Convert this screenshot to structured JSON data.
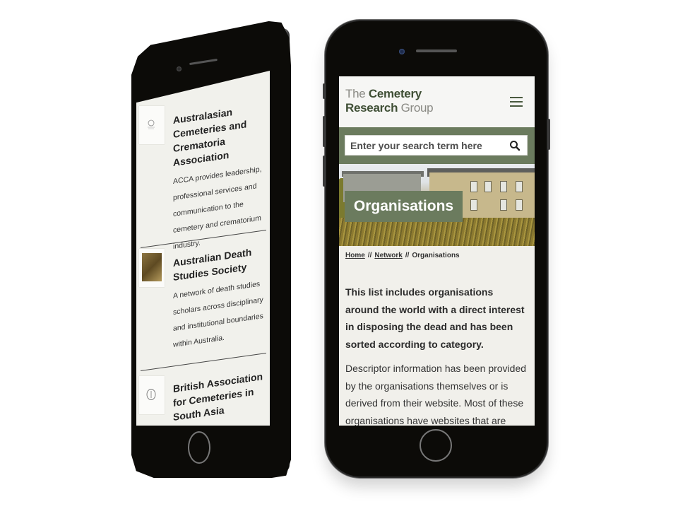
{
  "right_phone": {
    "logo": {
      "line1_light": "The",
      "line1_dark": "Cemetery",
      "line2_dark": "Research",
      "line2_light": "Group"
    },
    "menu_icon": "hamburger-icon",
    "search": {
      "placeholder": "Enter your search term here",
      "value": "",
      "icon": "search-icon"
    },
    "hero": {
      "title": "Organisations"
    },
    "breadcrumb": {
      "items": [
        "Home",
        "Network",
        "Organisations"
      ],
      "separator": "//"
    },
    "content": {
      "lead": "This list includes organisations around the world with a direct interest in disposing the dead and has been sorted according to category.",
      "body": "Descriptor information has been provided by the organisations themselves or is derived from their website. Most of these organisations have websites that are"
    }
  },
  "left_phone": {
    "organisations": [
      {
        "name": "Australasian Cemeteries and Crematoria Association",
        "description": "ACCA provides leadership, professional services and communication to the cemetery and crematorium industry.",
        "thumb": "acca-logo"
      },
      {
        "name": "Australian Death Studies Society",
        "description": "A network of death studies scholars across disciplinary and institutional boundaries within Australia.",
        "thumb": "owl-photo"
      },
      {
        "name": "British Association for Cemeteries in South Asia",
        "description": "",
        "thumb": "seal-logo"
      }
    ]
  },
  "colors": {
    "brand_green": "#6b7b5e",
    "logo_dark_green": "#3f4f35",
    "logo_grey": "#8a8a84",
    "page_bg": "#f1f0eb",
    "phone_body": "#0c0b08"
  }
}
